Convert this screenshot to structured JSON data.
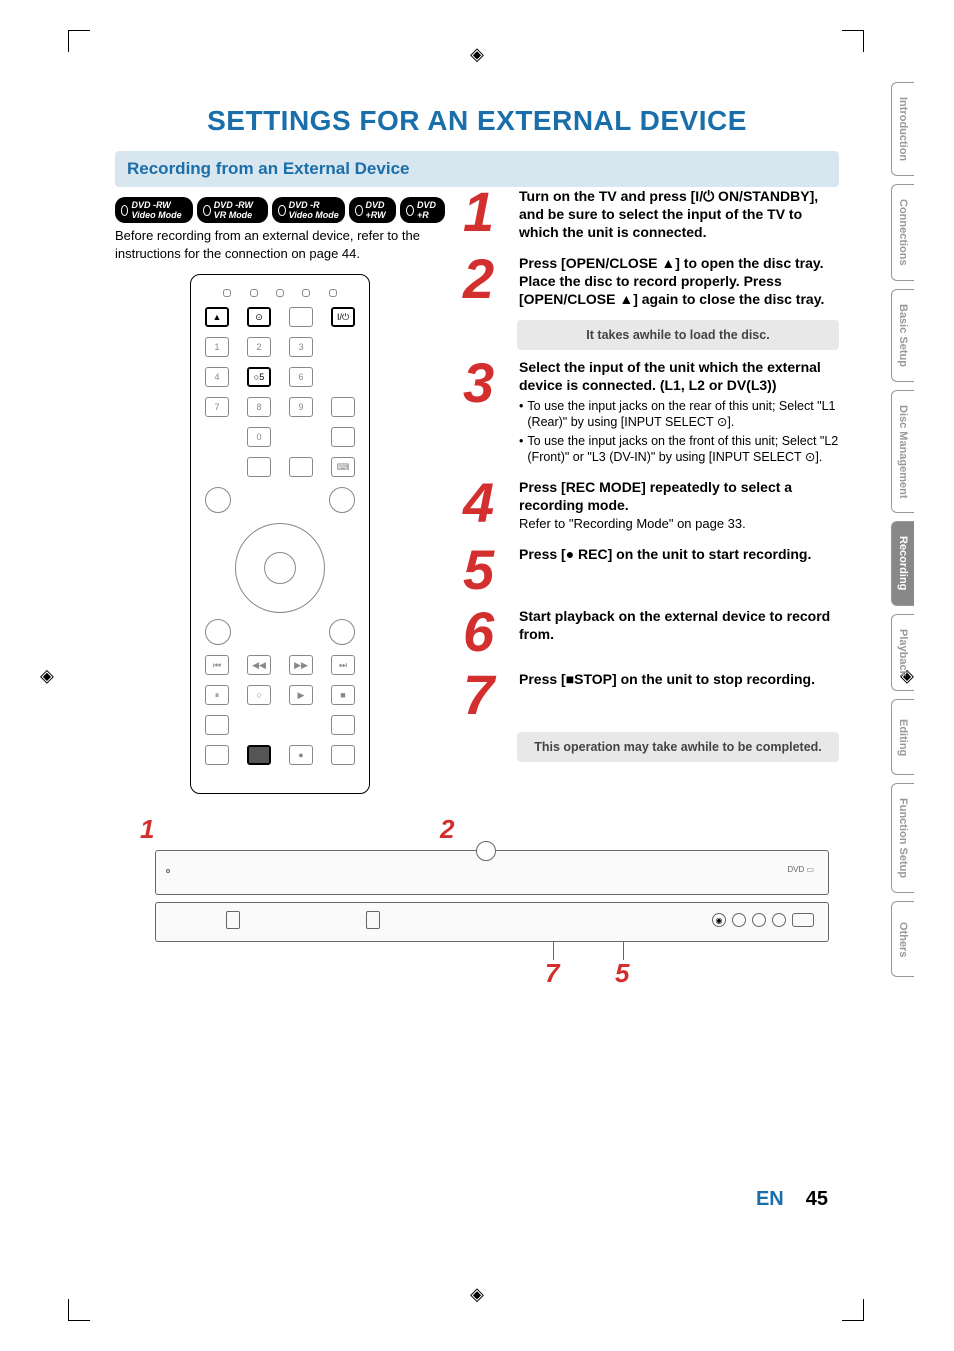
{
  "title": "SETTINGS FOR AN EXTERNAL DEVICE",
  "section_header": "Recording from an External Device",
  "badges": [
    "DVD -RW Video Mode",
    "DVD -RW VR Mode",
    "DVD -R Video Mode",
    "DVD +RW",
    "DVD +R"
  ],
  "intro": "Before recording from an external device, refer to the instructions for the connection on page 44.",
  "steps": {
    "s1": {
      "num": "1",
      "bold": "Turn on the TV and press [I/⏻ ON/STANDBY], and be sure to select the input of the TV to which the unit is connected."
    },
    "s2": {
      "num": "2",
      "bold": "Press [OPEN/CLOSE ▲] to open the disc tray. Place the disc to record properly. Press [OPEN/CLOSE ▲] again to close the disc tray.",
      "note": "It takes awhile to load the disc."
    },
    "s3": {
      "num": "3",
      "bold": "Select the input of the unit which the external device is connected. (L1, L2 or DV(L3))",
      "b1": "To use the input jacks on the rear of this unit; Select \"L1 (Rear)\" by using [INPUT SELECT ⊙].",
      "b2": "To use the input jacks on the front of this unit; Select \"L2 (Front)\" or \"L3 (DV-IN)\" by using [INPUT SELECT ⊙]."
    },
    "s4": {
      "num": "4",
      "bold": "Press [REC MODE] repeatedly to select a recording mode.",
      "text": "Refer to \"Recording Mode\" on page 33."
    },
    "s5": {
      "num": "5",
      "bold": "Press [● REC] on the unit to start recording."
    },
    "s6": {
      "num": "6",
      "bold": "Start playback on the external device to record from."
    },
    "s7": {
      "num": "7",
      "bold": "Press [■STOP] on the unit to stop recording.",
      "note": "This operation may take awhile to be completed."
    }
  },
  "diagram_callouts": {
    "c1": "1",
    "c2": "2",
    "c7": "7",
    "c5": "5"
  },
  "tabs": {
    "t1": "Introduction",
    "t2": "Connections",
    "t3": "Basic Setup",
    "t4": "Disc Management",
    "t5": "Recording",
    "t6": "Playback",
    "t7": "Editing",
    "t8": "Function Setup",
    "t9": "Others"
  },
  "footer": {
    "lang": "EN",
    "page": "45"
  }
}
